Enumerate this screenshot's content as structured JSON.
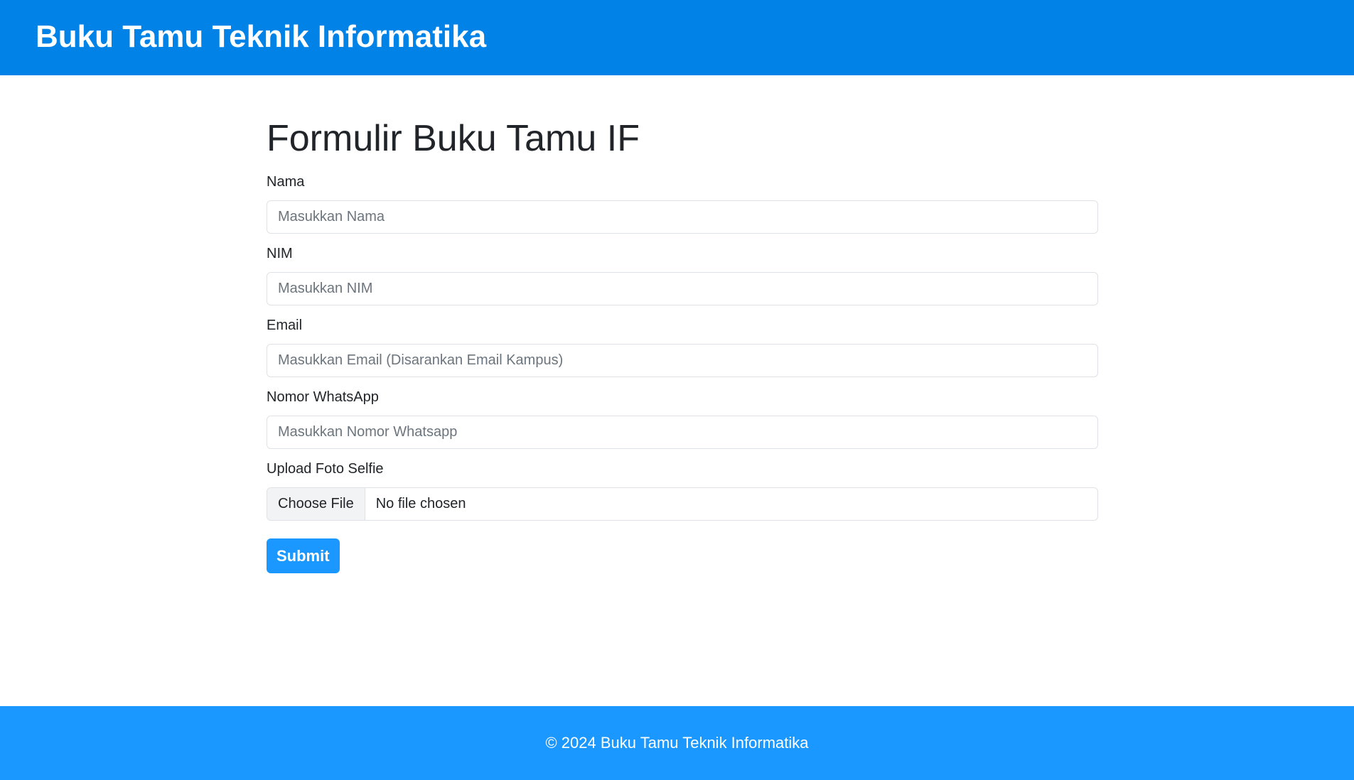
{
  "header": {
    "title": "Buku Tamu Teknik Informatika",
    "background_color": "#0082e6"
  },
  "form": {
    "title": "Formulir Buku Tamu IF",
    "fields": {
      "nama": {
        "label": "Nama",
        "placeholder": "Masukkan Nama",
        "value": ""
      },
      "nim": {
        "label": "NIM",
        "placeholder": "Masukkan NIM",
        "value": ""
      },
      "email": {
        "label": "Email",
        "placeholder": "Masukkan Email (Disarankan Email Kampus)",
        "value": ""
      },
      "whatsapp": {
        "label": "Nomor WhatsApp",
        "placeholder": "Masukkan Nomor Whatsapp",
        "value": ""
      },
      "foto": {
        "label": "Upload Foto Selfie",
        "button_label": "Choose File",
        "status": "No file chosen"
      }
    },
    "submit_label": "Submit",
    "accent_color": "#1a98ff"
  },
  "footer": {
    "text": "© 2024 Buku Tamu Teknik Informatika",
    "background_color": "#1a98ff"
  }
}
